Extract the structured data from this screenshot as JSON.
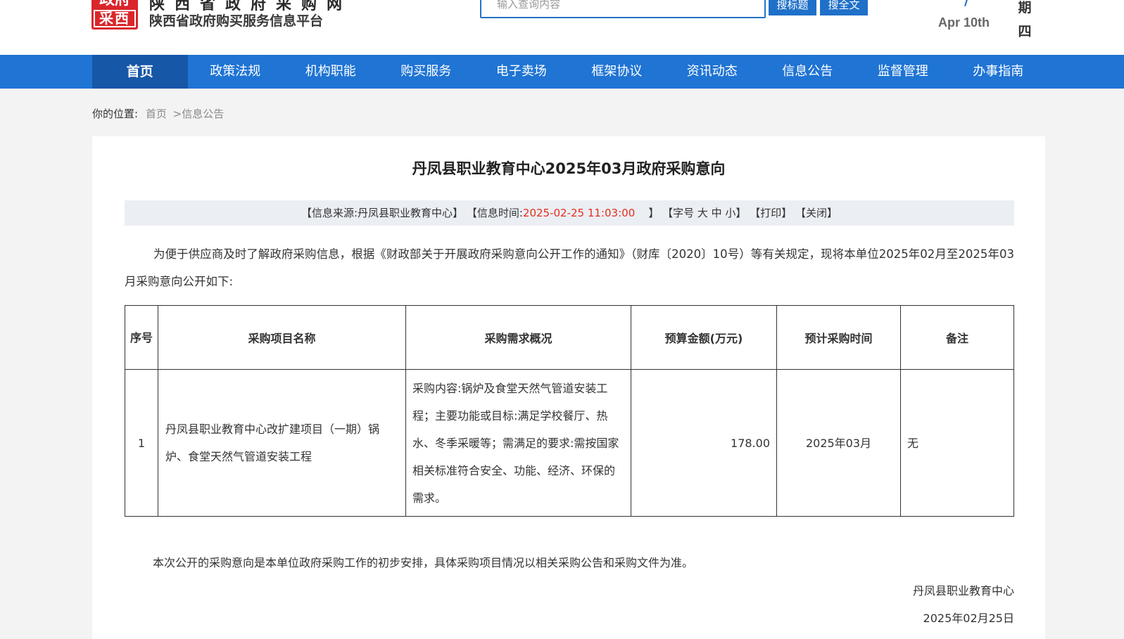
{
  "header": {
    "logo_top": "政府",
    "logo_bottom": "采西",
    "title": "陕西省政府采购网",
    "subtitle": "陕西省政府购买服务信息平台",
    "search_placeholder": "输入查询内容",
    "btn_search_title": "搜标题",
    "btn_search_full": "搜全文",
    "date_accent": "/",
    "date_en": "Apr 10th",
    "weekday_1": "期",
    "weekday_2": "四"
  },
  "nav": {
    "items": [
      "首页",
      "政策法规",
      "机构职能",
      "购买服务",
      "电子卖场",
      "框架协议",
      "资讯动态",
      "信息公告",
      "监督管理",
      "办事指南"
    ],
    "active_index": 0
  },
  "breadcrumb": {
    "label": "你的位置:",
    "home": "首页",
    "separator": ">",
    "current": "信息公告"
  },
  "article": {
    "title": "丹凤县职业教育中心2025年03月政府采购意向",
    "meta": {
      "source_prefix": "【信息来源:",
      "source": "丹凤县职业教育中心",
      "source_suffix": "】",
      "time_prefix": "【信息时间:",
      "time": "2025-02-25 11:03:00",
      "time_suffix": "】",
      "font_size": "【字号 大 中 小】",
      "print": "【打印】",
      "close": "【关闭】"
    },
    "intro": "为便于供应商及时了解政府采购信息，根据《财政部关于开展政府采购意向公开工作的通知》（财库〔2020〕10号）等有关规定，现将本单位2025年02月至2025年03月采购意向公开如下:",
    "table": {
      "headers": [
        "序号",
        "采购项目名称",
        "采购需求概况",
        "预算金额(万元)",
        "预计采购时间",
        "备注"
      ],
      "rows": [
        {
          "index": "1",
          "name": "丹凤县职业教育中心改扩建项目（一期）锅炉、食堂天然气管道安装工程",
          "summary": "采购内容:锅炉及食堂天然气管道安装工程；主要功能或目标:满足学校餐厅、热水、冬季采暖等；需满足的要求:需按国家相关标准符合安全、功能、经济、环保的需求。",
          "budget": "178.00",
          "time": "2025年03月",
          "note": "无"
        }
      ]
    },
    "closing": "本次公开的采购意向是本单位政府采购工作的初步安排，具体采购项目情况以相关采购公告和采购文件为准。",
    "signer": "丹凤县职业教育中心",
    "sign_date": "2025年02月25日"
  },
  "colors": {
    "nav_bg": "#1f74d4",
    "nav_active": "#1757a8",
    "accent_red": "#e52d1c",
    "logo_red": "#d9262b"
  }
}
